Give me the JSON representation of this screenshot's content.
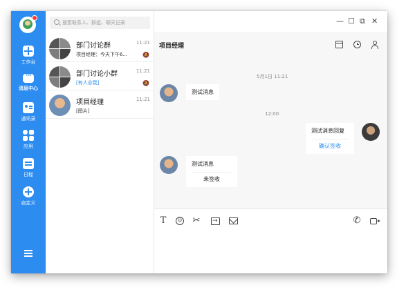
{
  "nav": {
    "items": [
      {
        "label": "工作台",
        "icon": "workbench-icon"
      },
      {
        "label": "消息中心",
        "icon": "message-icon"
      },
      {
        "label": "通讯录",
        "icon": "contacts-icon"
      },
      {
        "label": "应用",
        "icon": "apps-icon"
      },
      {
        "label": "日程",
        "icon": "schedule-icon"
      },
      {
        "label": "自定义",
        "icon": "add-icon"
      }
    ]
  },
  "search": {
    "placeholder": "搜索联系人、群组、聊天记录"
  },
  "conversations": [
    {
      "name": "部门讨论群",
      "preview": "项目经理：今天下午6...",
      "time": "11:21",
      "muted": true
    },
    {
      "name": "部门讨论小群",
      "preview": "[有人@我]",
      "time": "11:21",
      "muted": true
    },
    {
      "name": "项目经理",
      "preview": "[图片]",
      "time": "11:21",
      "muted": false
    }
  ],
  "window_controls": {
    "minimize": "—",
    "maximize": "☐",
    "restore": "⧉",
    "close": "✕"
  },
  "chat": {
    "title": "项目经理",
    "timestamps": [
      "5月1日 11:21",
      "12:00"
    ],
    "messages": [
      {
        "side": "left",
        "text": "测试消息"
      },
      {
        "side": "right",
        "text": "测试消息回复",
        "action": "确认签收"
      },
      {
        "side": "left",
        "text": "测试消息",
        "status": "未签收"
      }
    ]
  },
  "toolbar": {
    "text_tool": "T",
    "emoji_tool": "☺",
    "scissors_tool": "✂",
    "phone_tool": "✆"
  },
  "colors": {
    "accent": "#2d8cf0",
    "nav_bg": "#2d8cf0"
  }
}
